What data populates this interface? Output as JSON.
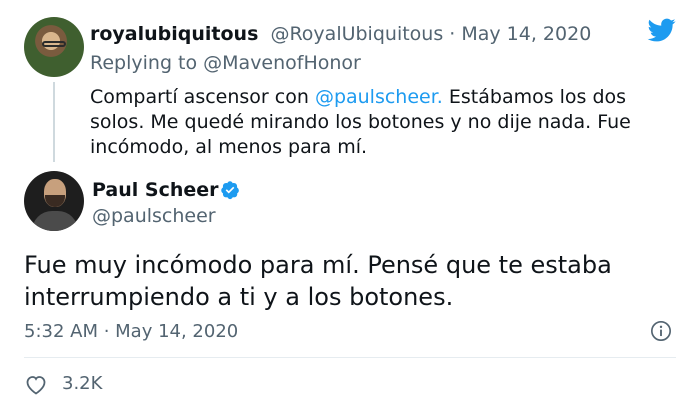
{
  "reply_tweet": {
    "display_name": "royalubiquitous",
    "handle": "@RoyalUbiquitous",
    "separator": " · ",
    "date": "May 14, 2020",
    "replying_prefix": "Replying to ",
    "replying_to": "@MavenofHonor",
    "text_before_mention": "Compartí ascensor con ",
    "mention": "@paulscheer.",
    "text_after_mention": " Estábamos los dos solos. Me quedé mirando los botones y no dije nada. Fue incómodo, al menos para mí."
  },
  "main_tweet": {
    "display_name": "Paul Scheer",
    "handle": "@paulscheer",
    "verified": true,
    "text": "Fue muy incómodo para mí. Pensé que te estaba interrumpiendo a ti y a los botones.",
    "timestamp": "5:32 AM · May 14, 2020",
    "likes": "3.2K"
  },
  "icons": {
    "brand": "twitter-bird-icon",
    "verified": "verified-badge-icon",
    "info": "info-icon",
    "like": "heart-icon"
  },
  "colors": {
    "brand": "#1d9bf0",
    "secondary_text": "#536471",
    "primary_text": "#0f1419"
  }
}
